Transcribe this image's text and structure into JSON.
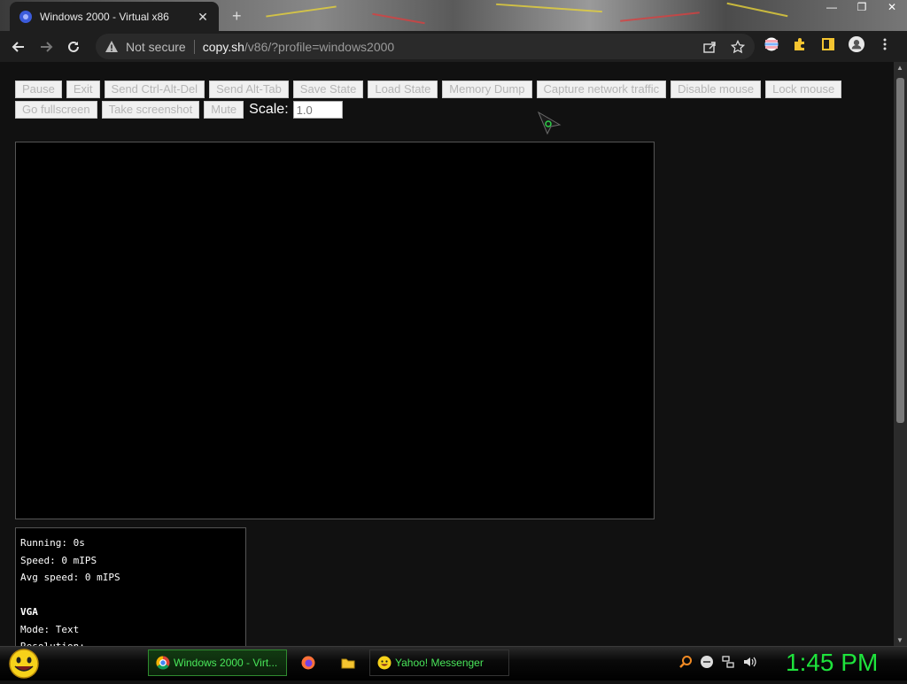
{
  "browser": {
    "tab_title": "Windows 2000 - Virtual x86",
    "security_label": "Not secure",
    "url_host": "copy.sh",
    "url_path": "/v86/?profile=windows2000"
  },
  "controls": {
    "buttons": [
      "Pause",
      "Exit",
      "Send Ctrl-Alt-Del",
      "Send Alt-Tab",
      "Save State",
      "Load State",
      "Memory Dump",
      "Capture network traffic",
      "Disable mouse",
      "Lock mouse",
      "Go fullscreen",
      "Take screenshot",
      "Mute"
    ],
    "scale_label": "Scale:",
    "scale_value": "1.0"
  },
  "stats": {
    "running": "Running: 0s",
    "speed": "Speed: 0 mIPS",
    "avg_speed": "Avg speed: 0 mIPS",
    "vga_heading": "VGA",
    "mode": "Mode: Text",
    "resolution": "Resolution:"
  },
  "taskbar": {
    "tasks": [
      "Windows 2000 - Virt...",
      "Yahoo! Messenger"
    ],
    "clock": "1:45 PM"
  },
  "colors": {
    "clock": "#1ee33c",
    "task_text": "#49e65a",
    "page_bg": "#111111"
  }
}
